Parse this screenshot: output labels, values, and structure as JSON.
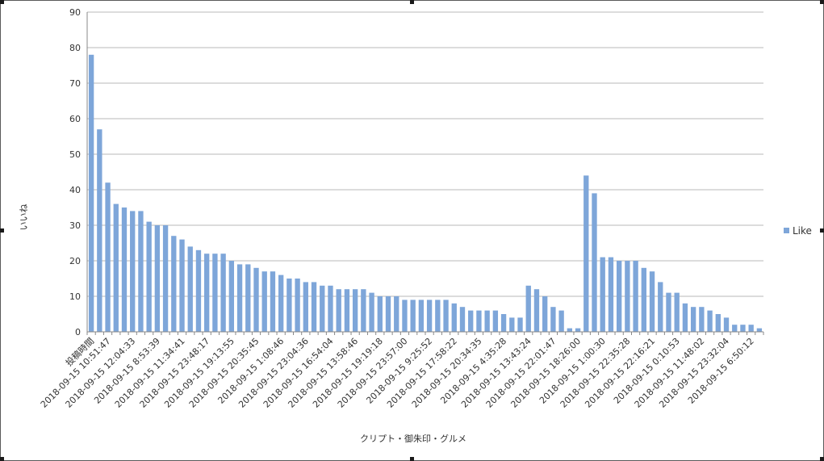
{
  "chart_data": {
    "type": "bar",
    "title": "",
    "xlabel": "クリプト・御朱印・グルメ",
    "ylabel": "いいね",
    "ylim": [
      0,
      90
    ],
    "yticks": [
      0,
      10,
      20,
      30,
      40,
      50,
      60,
      70,
      80,
      90
    ],
    "grid": true,
    "legend_position": "right",
    "bar_color": "#7ea6d9",
    "categories": [
      "投稿時間",
      "",
      "2018-09-15 10:51:47",
      "",
      "",
      "2018-09-15 12:04:33",
      "",
      "",
      "2018-09-15 8:53:39",
      "",
      "",
      "2018-09-15 11:34:41",
      "",
      "",
      "2018-09-15 23:48:17",
      "",
      "",
      "2018-09-15 19:13:55",
      "",
      "",
      "2018-09-15 20:35:45",
      "",
      "",
      "2018-09-15 1:08:46",
      "",
      "",
      "2018-09-15 23:04:36",
      "",
      "",
      "2018-09-15 16:54:04",
      "",
      "",
      "2018-09-15 13:58:46",
      "",
      "",
      "2018-09-15 19:19:18",
      "",
      "",
      "2018-09-15 23:57:00",
      "",
      "",
      "2018-09-15 9:25:52",
      "",
      "",
      "2018-09-15 17:58:22",
      "",
      "",
      "2018-09-15 20:34:35",
      "",
      "",
      "2018-09-15 4:35:28",
      "",
      "",
      "2018-09-15 13:43:24",
      "",
      "",
      "2018-09-15 22:01:47",
      "",
      "",
      "2018-09-15 18:26:00",
      "",
      "",
      "2018-09-15 1:00:30",
      "",
      "",
      "2018-09-15 22:35:28",
      "",
      "",
      "2018-09-15 22:16:21",
      "",
      "",
      "2018-09-15 0:10:53",
      "",
      "",
      "2018-09-15 11:48:02",
      "",
      "",
      "2018-09-15 23:32:04",
      "",
      "",
      "2018-09-15 6:50:12"
    ],
    "series": [
      {
        "name": "Like",
        "values": [
          78,
          57,
          42,
          36,
          35,
          34,
          34,
          31,
          30,
          30,
          27,
          26,
          24,
          23,
          22,
          22,
          22,
          20,
          19,
          19,
          18,
          17,
          17,
          16,
          15,
          15,
          14,
          14,
          13,
          13,
          12,
          12,
          12,
          12,
          11,
          10,
          10,
          10,
          9,
          9,
          9,
          9,
          9,
          9,
          8,
          7,
          6,
          6,
          6,
          6,
          5,
          4,
          4,
          13,
          12,
          10,
          7,
          6,
          1,
          1,
          44,
          39,
          21,
          21,
          20,
          20,
          20,
          18,
          17,
          14,
          11,
          11,
          8,
          7,
          7,
          6,
          5,
          4,
          2,
          2,
          2,
          1
        ]
      }
    ]
  }
}
